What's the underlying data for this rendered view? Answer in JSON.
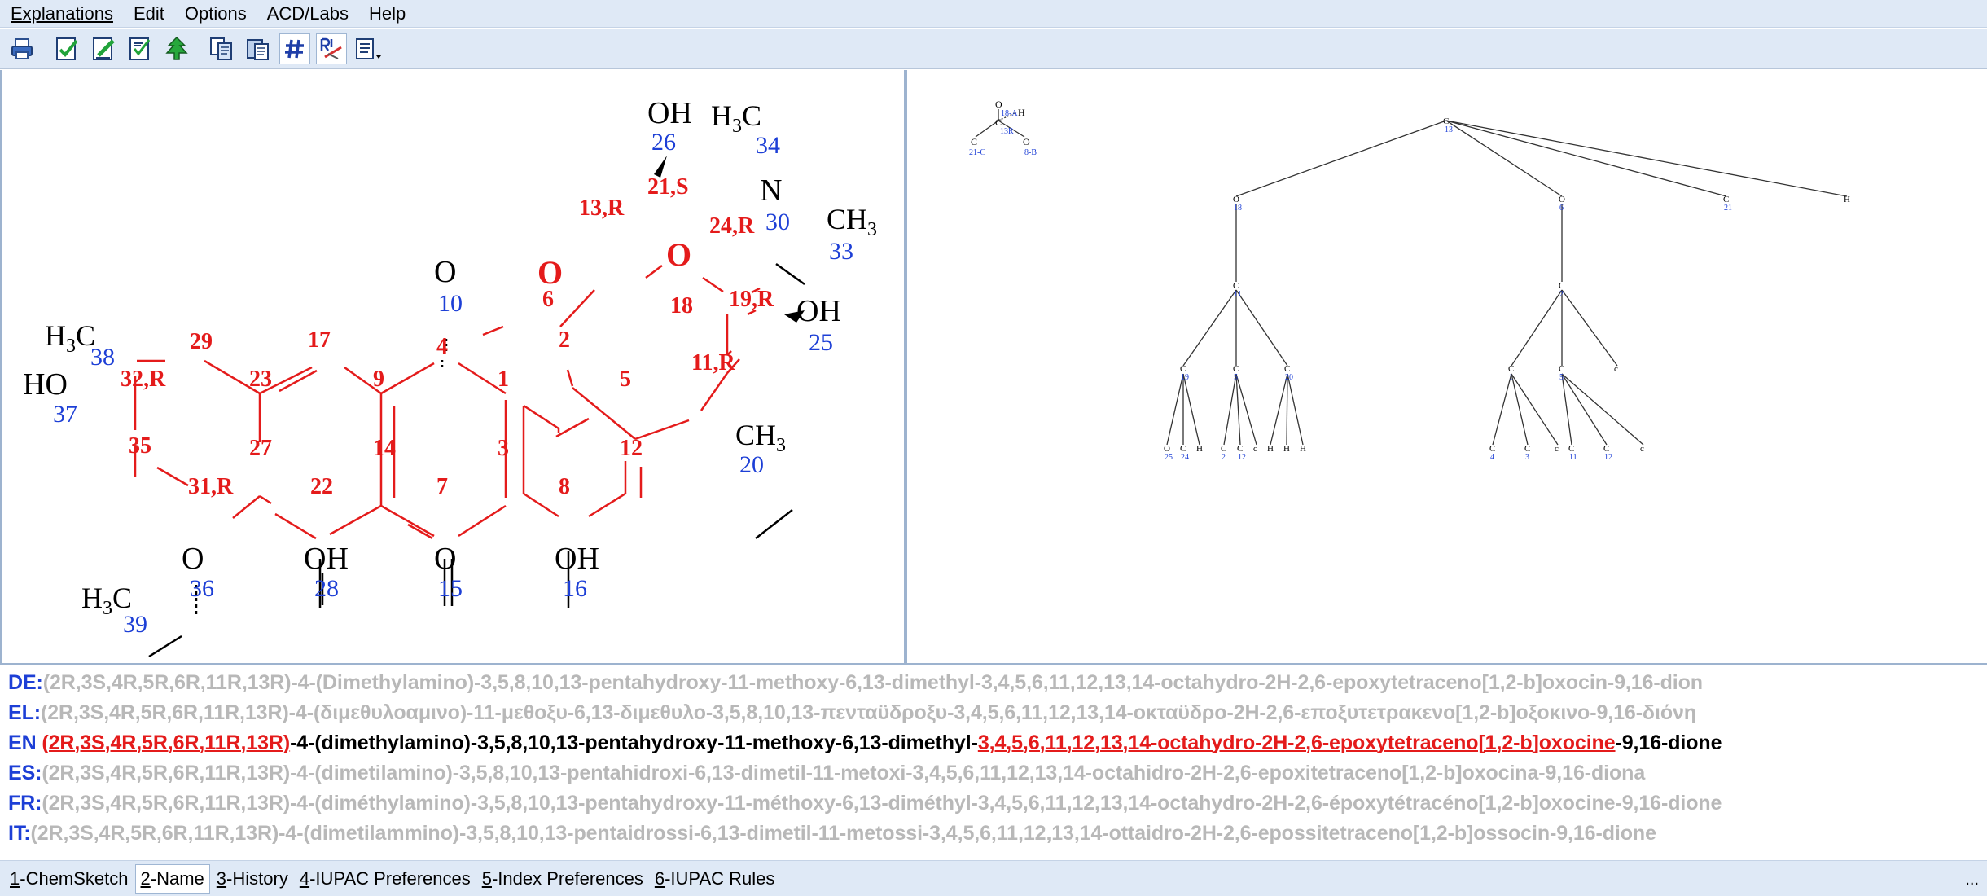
{
  "menu": [
    "Explanations",
    "Edit",
    "Options",
    "ACD/Labs",
    "Help"
  ],
  "toolbar": {
    "buttons": [
      "print-icon",
      "doc-check-icon",
      "doc-edit-icon",
      "doc-compare-icon",
      "tree-icon",
      "copy-icon",
      "paste-icon",
      "numbering-icon",
      "rule-icon",
      "options-icon"
    ]
  },
  "structure": {
    "locants": {
      "n1": "1",
      "n2": "2",
      "n3": "3",
      "n4": "4",
      "n5": "5",
      "n6": "6",
      "n7": "7",
      "n8": "8",
      "n9": "9",
      "n11": "11,R",
      "n12": "12",
      "n13": "13,R",
      "n14": "14",
      "n17": "17",
      "n18": "18",
      "n19": "19,R",
      "n21": "21,S",
      "n22": "22",
      "n23": "23",
      "n24": "24,R",
      "n27": "27",
      "n29": "29",
      "n31": "31,R",
      "n32": "32,R",
      "n35": "35"
    },
    "atom_numbers": {
      "a10": "10",
      "a15": "15",
      "a16": "16",
      "a20": "20",
      "a25": "25",
      "a26": "26",
      "a28": "28",
      "a30": "30",
      "a33": "33",
      "a34": "34",
      "a36": "36",
      "a37": "37",
      "a38": "38",
      "a39": "39"
    },
    "labels": {
      "oh": "OH",
      "ho": "HO",
      "o": "O",
      "n": "N",
      "c": "C",
      "h": "H",
      "h3": "3",
      "ch": "CH"
    }
  },
  "tree": {
    "root": "13",
    "inset": {
      "o": "O",
      "o_num": "18-A",
      "h": "H",
      "c": "C",
      "c_num": "13R",
      "left": "C",
      "left_num": "21-C",
      "right": "O",
      "right_num": "8-B"
    },
    "level1": [
      {
        "a": "O",
        "n": "18"
      },
      {
        "a": "O",
        "n": "6"
      },
      {
        "a": "C",
        "n": "21"
      },
      {
        "a": "H",
        "n": ""
      }
    ],
    "level2": [
      {
        "a": "C",
        "n": "11"
      },
      {
        "a": "C",
        "n": "2"
      }
    ],
    "level3": [
      {
        "a": "C",
        "n": "19"
      },
      {
        "a": "C",
        "n": "5"
      },
      {
        "a": "C",
        "n": "20"
      },
      {
        "a": "C",
        "n": "1"
      },
      {
        "a": "C",
        "n": "5"
      },
      {
        "a": "c",
        "n": ""
      }
    ],
    "level4": [
      {
        "a": "O",
        "n": "25"
      },
      {
        "a": "C",
        "n": "24"
      },
      {
        "a": "H",
        "n": ""
      },
      {
        "a": "C",
        "n": "2"
      },
      {
        "a": "C",
        "n": "12"
      },
      {
        "a": "c",
        "n": ""
      },
      {
        "a": "H",
        "n": ""
      },
      {
        "a": "H",
        "n": ""
      },
      {
        "a": "H",
        "n": ""
      },
      {
        "a": "C",
        "n": "4"
      },
      {
        "a": "C",
        "n": "3"
      },
      {
        "a": "c",
        "n": ""
      },
      {
        "a": "C",
        "n": "11"
      },
      {
        "a": "C",
        "n": "12"
      },
      {
        "a": "c",
        "n": ""
      }
    ]
  },
  "names": [
    {
      "lang": "DE:",
      "stereo": "(2R,3S,4R,5R,6R,11R,13R)",
      "text": "-4-(Dimethylamino)-3,5,8,10,13-pentahydroxy-11-methoxy-6,13-dimethyl-3,4,5,6,11,12,13,14-octahydro-2H-2,6-epoxytetraceno[1,2-b]oxocin-9,16-dion"
    },
    {
      "lang": "EL:",
      "stereo": "(2R,3S,4R,5R,6R,11R,13R)",
      "text": "-4-(διμεθυλοαμινο)-11-μεθοξυ-6,13-διμεθυλο-3,5,8,10,13-πενταϋδροξυ-3,4,5,6,11,12,13,14-οκταϋδρο-2H-2,6-εποξυτετρακενο[1,2-b]οξοκινο-9,16-διόνη"
    },
    {
      "lang": "EN",
      "stereo": "(2R,3S,4R,5R,6R,11R,13R)",
      "mid": "-4-(dimethylamino)-3,5,8,10,13-pentahydroxy-11-methoxy-6,13-dimethyl-",
      "hl": "3,4,5,6,11,12,13,14-octahydro-2H-2,6-epoxytetraceno[1,2-b]oxocine",
      "end": "-9,16-dione"
    },
    {
      "lang": "ES:",
      "stereo": "(2R,3S,4R,5R,6R,11R,13R)",
      "text": "-4-(dimetilamino)-3,5,8,10,13-pentahidroxi-6,13-dimetil-11-metoxi-3,4,5,6,11,12,13,14-octahidro-2H-2,6-epoxitetraceno[1,2-b]oxocina-9,16-diona"
    },
    {
      "lang": "FR:",
      "stereo": "(2R,3S,4R,5R,6R,11R,13R)",
      "text": "-4-(diméthylamino)-3,5,8,10,13-pentahydroxy-11-méthoxy-6,13-diméthyl-3,4,5,6,11,12,13,14-octahydro-2H-2,6-époxytétracéno[1,2-b]oxocine-9,16-dione"
    },
    {
      "lang": "IT:",
      "stereo": "(2R,3S,4R,5R,6R,11R,13R)",
      "text": "-4-(dimetilammino)-3,5,8,10,13-pentaidrossi-6,13-dimetil-11-metossi-3,4,5,6,11,12,13,14-ottaidro-2H-2,6-epossitetraceno[1,2-b]ossocin-9,16-dione"
    }
  ],
  "tabs": [
    {
      "key": "1",
      "label": "-ChemSketch"
    },
    {
      "key": "2",
      "label": "-Name"
    },
    {
      "key": "3",
      "label": "-History"
    },
    {
      "key": "4",
      "label": "-IUPAC Preferences"
    },
    {
      "key": "5",
      "label": "-Index Preferences"
    },
    {
      "key": "6",
      "label": "-IUPAC Rules"
    }
  ],
  "status_more": "...",
  "colors": {
    "locant": "#e41b1b",
    "atom_number": "#1d3fd6",
    "dim_text": "#b8b8b8",
    "panel": "#dfe9f6"
  }
}
